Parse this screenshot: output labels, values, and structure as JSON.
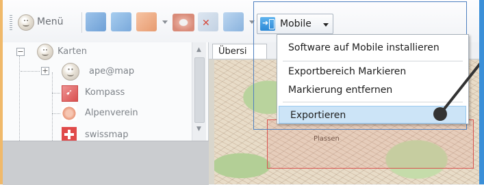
{
  "toolbar": {
    "menu_label": "Menü",
    "mobile_label": "Mobile",
    "icons": [
      "menu-smiley-icon",
      "track-blue-icon",
      "route-blue-icon",
      "zoom-magnifier-icon",
      "eye-icon",
      "delete-cross-icon",
      "arrow-right-icon"
    ]
  },
  "tree": {
    "items": [
      {
        "label": "Karten",
        "icon": "smiley-icon",
        "level": 0,
        "expander": "−"
      },
      {
        "label": "ape@map",
        "icon": "smiley-icon",
        "level": 1,
        "expander": "+"
      },
      {
        "label": "Kompass",
        "icon": "kompass-icon",
        "level": 1,
        "expander": ""
      },
      {
        "label": "Alpenverein",
        "icon": "alpenverein-icon",
        "level": 1,
        "expander": ""
      },
      {
        "label": "swissmap",
        "icon": "swissmap-icon",
        "level": 1,
        "expander": ""
      }
    ]
  },
  "map": {
    "tab_label": "Übersi",
    "place_label": "Plassen"
  },
  "mobile_menu": {
    "items": [
      {
        "label": "Software auf Mobile installieren"
      },
      {
        "label": "Exportbereich Markieren"
      },
      {
        "label": "Markierung entfernen"
      },
      {
        "label": "Exportieren",
        "highlighted": true
      }
    ]
  },
  "colors": {
    "highlight": "#cce4f7",
    "selection_frame": "#4d7fbf",
    "export_rect": "#d9534f",
    "accent_edge": "#3a8fd8"
  }
}
